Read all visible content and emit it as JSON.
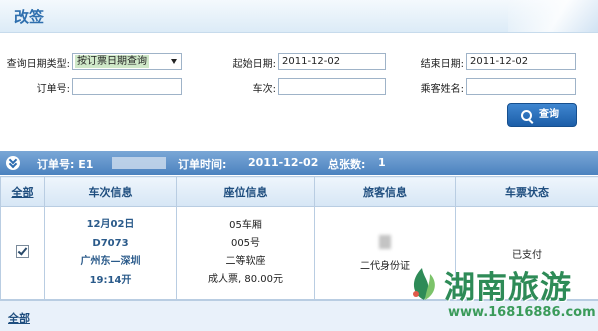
{
  "header": {
    "title": "改签"
  },
  "form": {
    "query_type_label": "查询日期类型:",
    "query_type_value": "按订票日期查询",
    "start_date_label": "起始日期:",
    "start_date_value": "2011-12-02",
    "end_date_label": "结束日期:",
    "end_date_value": "2011-12-02",
    "order_no_label": "订单号:",
    "order_no_value": "",
    "train_no_label": "车次:",
    "train_no_value": "",
    "passenger_label": "乘客姓名:",
    "passenger_value": "",
    "query_button": "查询"
  },
  "order": {
    "order_no_label": "订单号: E1",
    "order_time_label": "订单时间:",
    "order_time": "2011-12-02",
    "total_label": "总张数:",
    "total": "1"
  },
  "table": {
    "columns": [
      "全部",
      "车次信息",
      "座位信息",
      "旅客信息",
      "车票状态"
    ],
    "rows": [
      {
        "checked": true,
        "train": [
          "12月02日",
          "D7073",
          "广州东—深圳",
          "19:14开"
        ],
        "seat": [
          "05车厢",
          "005号",
          "二等软座",
          "成人票, 80.00元"
        ],
        "passenger": "二代身份证",
        "status": "已支付"
      }
    ],
    "footer_all": "全部"
  },
  "watermark": {
    "text": "湖南旅游",
    "url": "www.16816886.com"
  }
}
